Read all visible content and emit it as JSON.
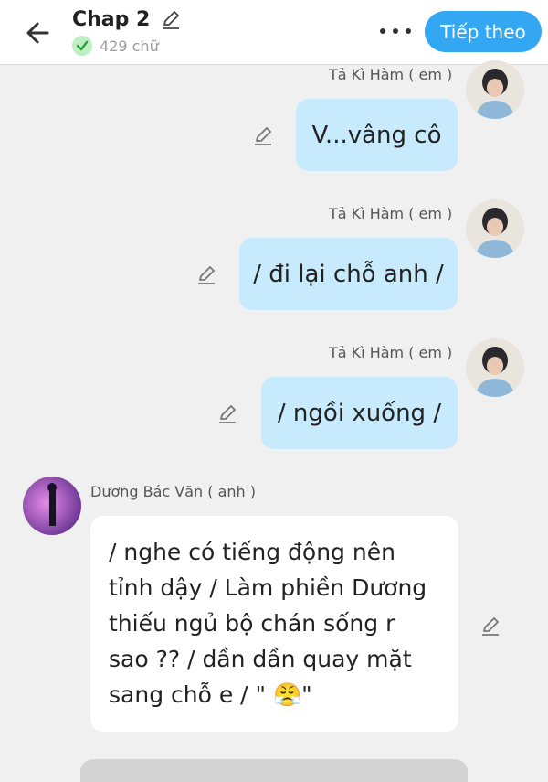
{
  "header": {
    "title": "Chap 2",
    "word_count": "429 chữ",
    "next_label": "Tiếp theo",
    "accent": "#34a7f3",
    "icons": [
      "back-arrow-icon",
      "pencil-icon",
      "check-icon",
      "more-dots-icon"
    ]
  },
  "messages": [
    {
      "sender": "Tả Kì Hàm ( em )",
      "text": "V...vâng cô"
    },
    {
      "sender": "Tả Kì Hàm ( em )",
      "text": "/ đi lại chỗ anh /"
    },
    {
      "sender": "Tả Kì Hàm ( em )",
      "text": "/ ngồi xuống /"
    },
    {
      "sender": "Dương Bác Văn ( anh )",
      "text": "/ nghe có tiếng động nên tỉnh dậy / Làm phiền Dương thiếu ngủ bộ chán sống r sao ?? / dần dần quay mặt sang chỗ e / \" 😤\""
    }
  ]
}
